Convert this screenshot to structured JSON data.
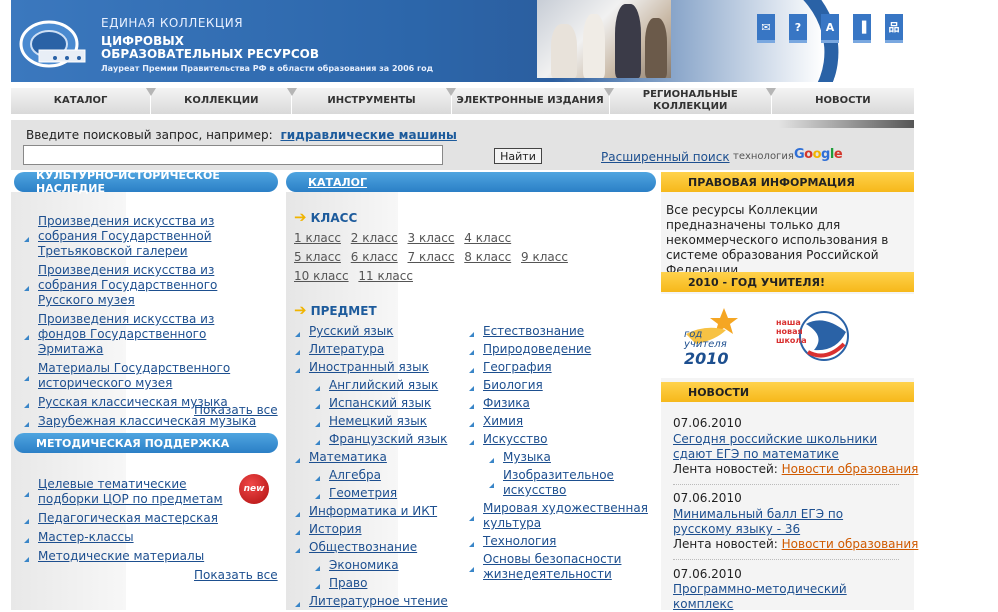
{
  "header": {
    "line1": "ЕДИНАЯ КОЛЛЕКЦИЯ",
    "line2": "ЦИФРОВЫХ",
    "line3": "ОБРАЗОВАТЕЛЬНЫХ РЕСУРСОВ",
    "tagline": "Лауреат Премии Правительства РФ в области образования за 2006 год",
    "icons": [
      {
        "name": "mail-icon",
        "glyph": "✉"
      },
      {
        "name": "help-icon",
        "glyph": "?"
      },
      {
        "name": "font-icon",
        "glyph": "A"
      },
      {
        "name": "stats-icon",
        "glyph": "▐"
      },
      {
        "name": "sitemap-icon",
        "glyph": "品"
      }
    ]
  },
  "nav": {
    "items": [
      {
        "label": "КАТАЛОГ"
      },
      {
        "label": "КОЛЛЕКЦИИ"
      },
      {
        "label": "ИНСТРУМЕНТЫ"
      },
      {
        "label": "ЭЛЕКТРОННЫЕ ИЗДАНИЯ"
      },
      {
        "label": "РЕГИОНАЛЬНЫЕ КОЛЛЕКЦИИ"
      },
      {
        "label": "НОВОСТИ"
      }
    ]
  },
  "search": {
    "prompt": "Введите поисковый запрос, например:",
    "example": "гидравлические машины",
    "value": "",
    "button": "Найти",
    "advanced": "Расширенный поиск",
    "tech": "технология",
    "google": "Google"
  },
  "left": {
    "heritage_title": "КУЛЬТУРНО-ИСТОРИЧЕСКОЕ НАСЛЕДИЕ",
    "heritage": [
      "Произведения искусства из собрания Государственной Третьяковской галереи",
      "Произведения искусства из собрания Государственного Русского музея",
      "Произведения искусства из фондов Государственного Эрмитажа",
      "Материалы Государственного исторического музея",
      "Русская классическая музыка",
      "Зарубежная классическая музыка"
    ],
    "show_all": "Показать все",
    "method_title": "МЕТОДИЧЕСКАЯ ПОДДЕРЖКА",
    "method": [
      "Целевые тематические подборки ЦОР по предметам",
      "Педагогическая мастерская",
      "Мастер-классы",
      "Методические материалы"
    ],
    "new_badge": "new",
    "show_all2": "Показать все"
  },
  "catalog": {
    "title": "КАТАЛОГ",
    "class_title": "КЛАСС",
    "grades_row1": [
      "1 класс",
      "2 класс",
      "3 класс",
      "4 класс"
    ],
    "grades_row2": [
      "5 класс",
      "6 класс",
      "7 класс",
      "8 класс",
      "9 класс"
    ],
    "grades_row3": [
      "10 класс",
      "11 класс"
    ],
    "subject_title": "ПРЕДМЕТ",
    "subjects_left": [
      {
        "label": "Русский язык",
        "sub": false
      },
      {
        "label": "Литература",
        "sub": false
      },
      {
        "label": "Иностранный язык",
        "sub": false
      },
      {
        "label": "Английский язык",
        "sub": true
      },
      {
        "label": "Испанский язык",
        "sub": true
      },
      {
        "label": "Немецкий язык",
        "sub": true
      },
      {
        "label": "Французский язык",
        "sub": true
      },
      {
        "label": "Математика",
        "sub": false
      },
      {
        "label": "Алгебра",
        "sub": true
      },
      {
        "label": "Геометрия",
        "sub": true
      },
      {
        "label": "Информатика и ИКТ",
        "sub": false
      },
      {
        "label": "История",
        "sub": false
      },
      {
        "label": "Обществознание",
        "sub": false
      },
      {
        "label": "Экономика",
        "sub": true
      },
      {
        "label": "Право",
        "sub": true
      },
      {
        "label": "Литературное чтение",
        "sub": false
      }
    ],
    "subjects_right": [
      {
        "label": "Естествознание",
        "sub": false
      },
      {
        "label": "Природоведение",
        "sub": false
      },
      {
        "label": "География",
        "sub": false
      },
      {
        "label": "Биология",
        "sub": false
      },
      {
        "label": "Физика",
        "sub": false
      },
      {
        "label": "Химия",
        "sub": false
      },
      {
        "label": "Искусство",
        "sub": false
      },
      {
        "label": "Музыка",
        "sub": true
      },
      {
        "label": "Изобразительное искусство",
        "sub": true
      },
      {
        "label": "Мировая художественная культура",
        "sub": false
      },
      {
        "label": "Технология",
        "sub": false
      },
      {
        "label": "Основы безопасности жизнедеятельности",
        "sub": false
      }
    ]
  },
  "right": {
    "legal_title": "ПРАВОВАЯ ИНФОРМАЦИЯ",
    "legal_text": "Все ресурсы Коллекции предназначены только для некоммерческого использования в системе образования Российской Федерации.",
    "year_title": "2010 - ГОД УЧИТЕЛЯ!",
    "year_logo_text1": "год",
    "year_logo_text2": "учителя",
    "year_logo_text3": "2010",
    "school_logo_text1": "наша",
    "school_logo_text2": "новая",
    "school_logo_text3": "школа",
    "news_title": "НОВОСТИ",
    "news": [
      {
        "date": "07.06.2010",
        "title": "Сегодня российские школьники сдают ЕГЭ по математике",
        "src_label": "Лента новостей:",
        "src": "Новости образования"
      },
      {
        "date": "07.06.2010",
        "title": "Минимальный балл ЕГЭ по русскому языку - 36",
        "src_label": "Лента новостей:",
        "src": "Новости образования"
      },
      {
        "date": "07.06.2010",
        "title": "Программно-методический комплекс",
        "src_label": "",
        "src": ""
      }
    ]
  }
}
